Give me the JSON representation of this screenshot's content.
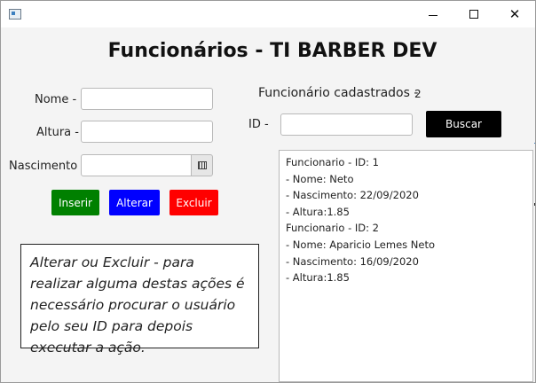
{
  "window": {
    "title": "Funcionários - TI BARBER DEV",
    "controls": {
      "minimize_icon": "minimize-icon",
      "maximize_icon": "maximize-icon",
      "close_glyph": "✕"
    }
  },
  "form": {
    "nome_label": "Nome -",
    "nome_value": "",
    "altura_label": "Altura -",
    "altura_value": "",
    "nascimento_label": "Nascimento -",
    "nascimento_value": "",
    "calendar_icon": "calendar-icon"
  },
  "buttons": {
    "inserir": "Inserir",
    "alterar": "Alterar",
    "excluir": "Excluir",
    "buscar": "Buscar"
  },
  "colors": {
    "inserir": "#008000",
    "alterar": "#0000ff",
    "excluir": "#ff0000",
    "buscar": "#000000"
  },
  "note": "Alterar ou Excluir - para realizar alguma destas ações é necessário procurar o usuário pelo seu ID para depois executar a ação.",
  "search": {
    "count_label": "Funcionário cadastrados -",
    "count_value": "2",
    "id_label": "ID -",
    "id_value": ""
  },
  "results": [
    "Funcionario - ID: 1",
    "- Nome: Neto",
    "- Nascimento: 22/09/2020",
    "- Altura:1.85",
    "Funcionario - ID: 2",
    "- Nome: Aparicio Lemes Neto",
    "- Nascimento: 16/09/2020",
    "- Altura:1.85"
  ]
}
